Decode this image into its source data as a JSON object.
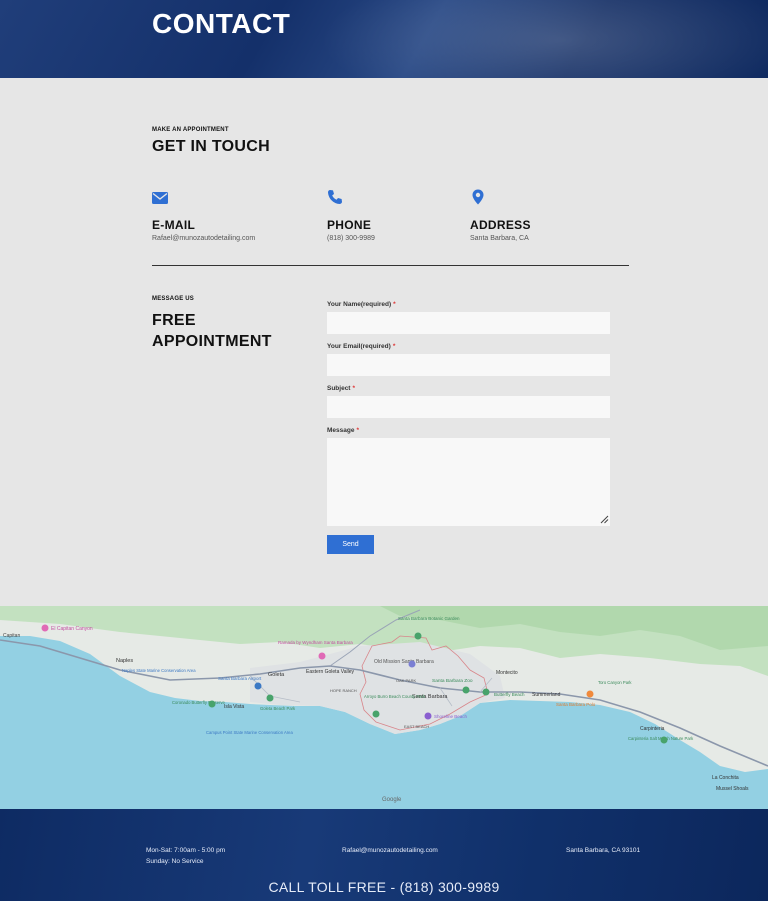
{
  "hero": {
    "title": "CONTACT"
  },
  "touch": {
    "eyebrow": "MAKE AN APPOINTMENT",
    "title": "GET IN TOUCH"
  },
  "info": [
    {
      "icon": "envelope-icon",
      "title": "E-MAIL",
      "value": "Rafael@munozautodetailing.com"
    },
    {
      "icon": "phone-icon",
      "title": "PHONE",
      "value": "(818) 300-9989"
    },
    {
      "icon": "map-pin-icon",
      "title": "ADDRESS",
      "value": "Santa Barbara, CA"
    }
  ],
  "message": {
    "eyebrow": "MESSAGE US",
    "title_line1": "FREE",
    "title_line2": "APPOINTMENT"
  },
  "form": {
    "name_label": "Your Name(required)",
    "email_label": "Your Email(required)",
    "subject_label": "Subject",
    "message_label": "Message",
    "required_mark": "*",
    "name_value": "",
    "email_value": "",
    "subject_value": "",
    "message_value": "",
    "send_label": "Send"
  },
  "map": {
    "labels": {
      "el_capitan": "El Capitan Canyon",
      "capitan": "Capitan",
      "naples": "Naples",
      "naples_marine": "Naples State Marine Conservation Area",
      "santa_barbara_airport": "Santa Barbara Airport",
      "goleta": "Goleta",
      "ramada": "Ramada by Wyndham Santa Barbara",
      "eastern_goleta": "Eastern Goleta Valley",
      "botanic": "Santa Barbara Botanic Garden",
      "old_mission": "Old Mission Santa Barbara",
      "montecito": "Montecito",
      "santa_barbara": "Santa Barbara",
      "zoo": "Santa Barbara Zoo",
      "butterfly": "Butterfly Beach",
      "summerland": "Summerland",
      "toro": "Toro Canyon Park",
      "polo": "Santa Barbara Polo",
      "coronado": "Coronado Butterfly Preserve",
      "isla_vista": "Isla Vista",
      "goleta_beach": "Goleta Beach Park",
      "arroyo": "Arroyo Burro Beach County Park",
      "shoreline": "Shoreline Beach",
      "hope_ranch": "HOPE RANCH",
      "oak_park": "OAK PARK",
      "east_beach": "EAST BEACH",
      "campus_point": "Campus Point State Marine Conservation Area",
      "carpinteria": "Carpinteria",
      "carpinteria_marsh": "Carpinteria Salt Marsh Nature Park",
      "la_conchita": "La Conchita",
      "mussel_shoals": "Mussel Shoals",
      "google": "Google"
    },
    "colors": {
      "ocean": "#93d0e3",
      "land": "#e7ebe7",
      "park": "#b9dcb5",
      "road": "#8a95a8"
    }
  },
  "footer": {
    "hours_line1": "Mon-Sat: 7:00am - 5:00 pm",
    "hours_line2": "Sunday: No Service",
    "email": "Rafael@munozautodetailing.com",
    "location": "Santa Barbara, CA 93101",
    "call": "CALL TOLL FREE - (818) 300-9989"
  },
  "colors": {
    "accent": "#2f6fd3",
    "hero_bg": "#163066",
    "footer_bg": "#10306a",
    "page_bg": "#e6e6e6"
  }
}
